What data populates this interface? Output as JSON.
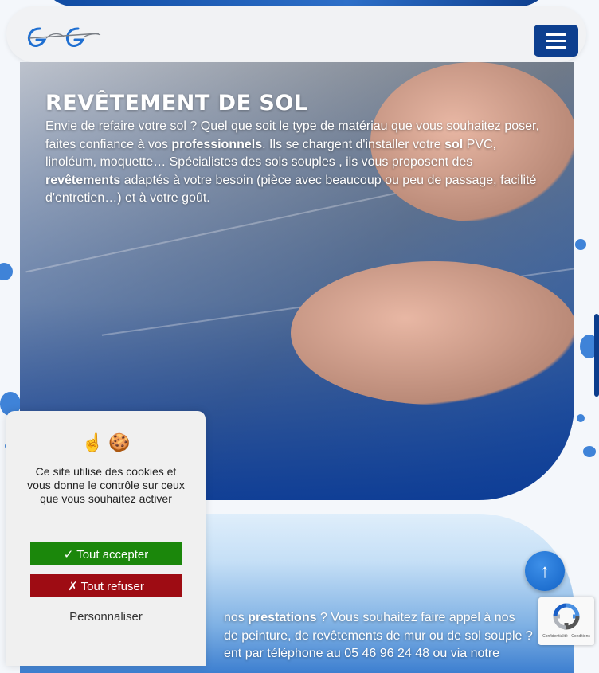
{
  "header": {
    "logo_alt": "logo",
    "menu_icon": "hamburger-menu-icon"
  },
  "service": {
    "title": "REVÊTEMENT DE SOL",
    "desc_1": "Envie de refaire votre sol ? Quel que soit le type de matériau que vous souhaitez poser, faites confiance à vos ",
    "desc_b1": "professionnels",
    "desc_2": ". Ils se chargent d'installer votre ",
    "desc_b2": "sol",
    "desc_3": " PVC, linoléum, moquette… Spécialistes des sols souples , ils vous proposent des ",
    "desc_b3": "revêtements",
    "desc_4": " adaptés à votre besoin (pièce avec beaucoup ou peu de passage, facilité d'entretien…) et à votre goût."
  },
  "contact": {
    "desc_1": "nos ",
    "desc_b1": "prestations",
    "desc_2": " ? Vous souhaitez faire appel à nos",
    "line2": "de peinture, de revêtements de mur ou de sol souple ?",
    "line3": "ent par téléphone au 05 46 96 24 48 ou via notre"
  },
  "cookies": {
    "icons": "☝ 🍪",
    "text": "Ce site utilise des cookies et vous donne le contrôle sur ceux que vous souhaitez activer",
    "accept": "✓ Tout accepter",
    "refuse": "✗ Tout refuser",
    "customize": "Personnaliser"
  },
  "to_top": "↑",
  "recaptcha": {
    "text": "Confidentialité - Conditions"
  },
  "colors": {
    "primary": "#0d3f8f",
    "accept": "#1b870b",
    "refuse": "#9e0c13"
  }
}
